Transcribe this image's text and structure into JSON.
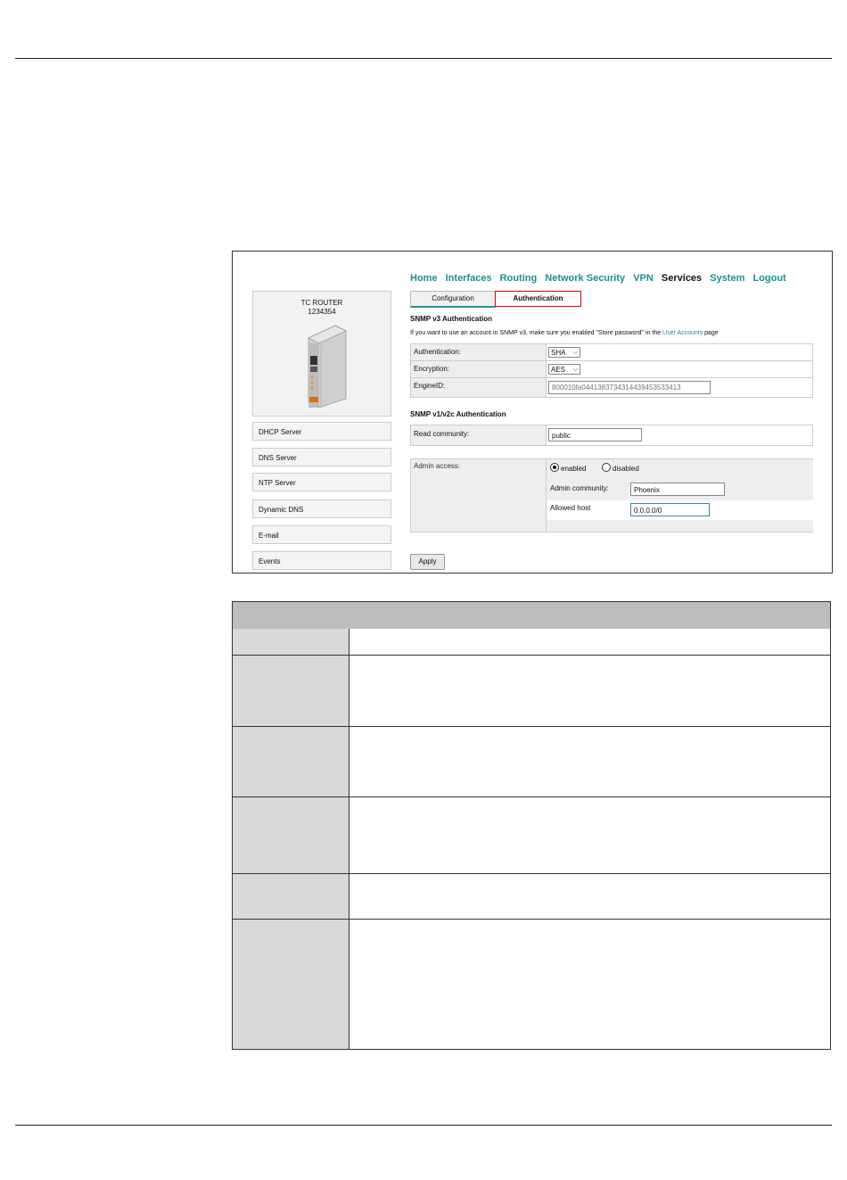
{
  "nav": [
    "Home",
    "Interfaces",
    "Routing",
    "Network Security",
    "VPN",
    "Services",
    "System",
    "Logout"
  ],
  "active_nav": "Services",
  "tabs": {
    "configuration": "Configuration",
    "authentication": "Authentication"
  },
  "device": {
    "name": "TC ROUTER",
    "serial": "1234354"
  },
  "sidebar": [
    "DHCP Server",
    "DNS Server",
    "NTP Server",
    "Dynamic DNS",
    "E-mail",
    "Events"
  ],
  "snmp_v3": {
    "title": "SNMP v3 Authentication",
    "info_prefix": "If you want to use an account in SNMP v3, make sure you enabled \"Store password\" in the ",
    "info_link": "User Accounts",
    "info_suffix": " page",
    "authentication_label": "Authentication:",
    "authentication_value": "SHA",
    "encryption_label": "Encryption:",
    "encryption_value": "AES",
    "engineid_label": "EngineID:",
    "engineid_placeholder": "800010fa0441383734314439453533413"
  },
  "snmp_v12": {
    "title": "SNMP v1/v2c Authentication",
    "read_community_label": "Read community:",
    "read_community_value": "public",
    "admin_access_label": "Admin access:",
    "enabled_label": "enabled",
    "disabled_label": "disabled",
    "admin_community_label": "Admin community:",
    "admin_community_value": "Phoenix",
    "allowed_host_label": "Allowed host",
    "allowed_host_value": "0.0.0.0/0"
  },
  "apply_label": "Apply",
  "colors": {
    "nav_link": "#1a8f96",
    "tab_highlight": "#dd0000"
  }
}
